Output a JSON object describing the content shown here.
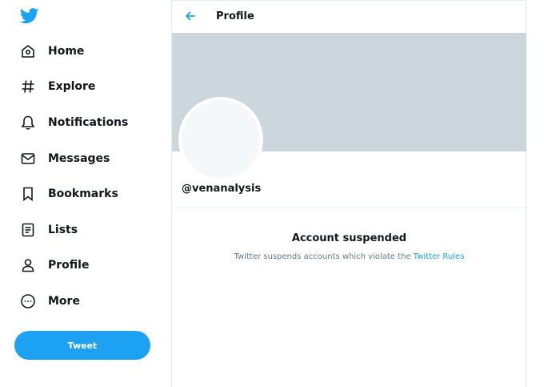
{
  "sidebar": {
    "logo_icon": "twitter-bird-icon",
    "items": [
      {
        "label": "Home",
        "icon": "home-icon"
      },
      {
        "label": "Explore",
        "icon": "hashtag-icon"
      },
      {
        "label": "Notifications",
        "icon": "bell-icon"
      },
      {
        "label": "Messages",
        "icon": "envelope-icon"
      },
      {
        "label": "Bookmarks",
        "icon": "bookmark-icon"
      },
      {
        "label": "Lists",
        "icon": "list-icon"
      },
      {
        "label": "Profile",
        "icon": "person-icon"
      },
      {
        "label": "More",
        "icon": "more-circle-icon"
      }
    ],
    "tweet_label": "Tweet"
  },
  "header": {
    "title": "Profile",
    "back_icon": "back-arrow-icon"
  },
  "profile": {
    "handle": "@venanalysis"
  },
  "suspension": {
    "title": "Account suspended",
    "description": "Twitter suspends accounts which violate the ",
    "link_text": "Twitter Rules"
  },
  "colors": {
    "accent": "#1da1f2",
    "banner": "#ccd6dd",
    "text": "#14171a",
    "muted": "#657786",
    "border": "#e6ecf0"
  }
}
